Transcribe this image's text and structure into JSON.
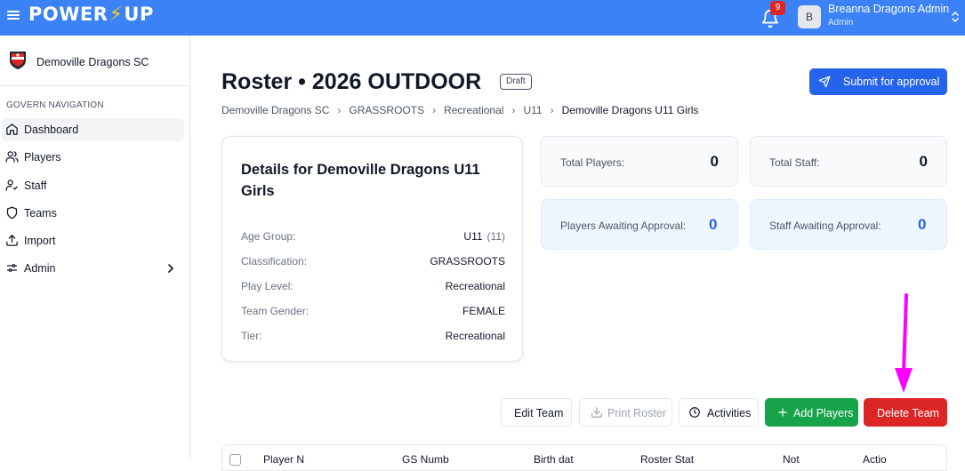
{
  "app": {
    "brand_left": "POWER",
    "brand_bolt": "⚡",
    "brand_right": "UP"
  },
  "topbar": {
    "notification_count": "9",
    "user_initial": "B",
    "user_name": "Breanna Dragons Admin",
    "user_role": "Admin"
  },
  "sidebar": {
    "club_name": "Demoville Dragons SC",
    "heading": "GOVERN NAVIGATION",
    "items": [
      {
        "label": "Dashboard",
        "icon": "home-icon",
        "active": true
      },
      {
        "label": "Players",
        "icon": "users-icon"
      },
      {
        "label": "Staff",
        "icon": "user-staff-icon"
      },
      {
        "label": "Teams",
        "icon": "shield-icon"
      },
      {
        "label": "Import",
        "icon": "upload-icon"
      },
      {
        "label": "Admin",
        "icon": "sliders-icon"
      }
    ]
  },
  "header": {
    "title": "Roster • 2026 OUTDOOR",
    "status_badge": "Draft",
    "submit_label": "Submit for approval"
  },
  "breadcrumb": [
    "Demoville Dragons SC",
    "GRASSROOTS",
    "Recreational",
    "U11",
    "Demoville Dragons U11 Girls"
  ],
  "details": {
    "title": "Details for Demoville Dragons U11 Girls",
    "rows": [
      {
        "label": "Age Group:",
        "value": "U11",
        "extra": "(11)"
      },
      {
        "label": "Classification:",
        "value": "GRASSROOTS"
      },
      {
        "label": "Play Level:",
        "value": "Recreational"
      },
      {
        "label": "Team Gender:",
        "value": "FEMALE"
      },
      {
        "label": "Tier:",
        "value": "Recreational"
      }
    ]
  },
  "stats": {
    "total_players": {
      "label": "Total Players:",
      "value": "0"
    },
    "total_staff": {
      "label": "Total Staff:",
      "value": "0"
    },
    "players_awaiting": {
      "label": "Players Awaiting Approval:",
      "value": "0"
    },
    "staff_awaiting": {
      "label": "Staff Awaiting Approval:",
      "value": "0"
    }
  },
  "actions": {
    "edit_team": "Edit Team",
    "print_roster": "Print Roster",
    "activities": "Activities",
    "add_players": "Add Players",
    "delete_team": "Delete Team"
  },
  "table": {
    "headers": [
      "Player N",
      "GS Numb",
      "Birth dat",
      "Roster Stat",
      "Not",
      "Actio"
    ]
  },
  "colors": {
    "topbar": "#3b82f6",
    "primary": "#2563eb",
    "success": "#16a34a",
    "danger": "#dc2626",
    "annotation_arrow": "#ff00ff"
  }
}
